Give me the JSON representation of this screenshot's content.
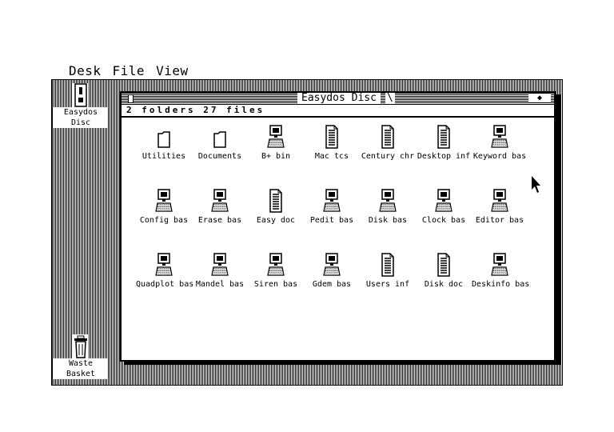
{
  "menubar": {
    "items": [
      "Desk",
      "File",
      "View"
    ]
  },
  "desktop": {
    "drive_icon_label": "Easydos Disc",
    "trash_icon_label": "Waste Basket"
  },
  "window": {
    "title": "Easydos Disc",
    "title_suffix": "\\",
    "fullbox": "◆",
    "info": "2 folders 27 files"
  },
  "files": [
    {
      "name": "Utilities",
      "icon": "folder-icon"
    },
    {
      "name": "Documents",
      "icon": "folder-icon"
    },
    {
      "name": "B+ bin",
      "icon": "program-icon"
    },
    {
      "name": "Mac tcs",
      "icon": "document-icon"
    },
    {
      "name": "Century chr",
      "icon": "document-icon"
    },
    {
      "name": "Desktop inf",
      "icon": "document-icon"
    },
    {
      "name": "Keyword bas",
      "icon": "program-icon"
    },
    {
      "name": "Config bas",
      "icon": "program-icon"
    },
    {
      "name": "Erase bas",
      "icon": "program-icon"
    },
    {
      "name": "Easy doc",
      "icon": "document-icon"
    },
    {
      "name": "Pedit bas",
      "icon": "program-icon"
    },
    {
      "name": "Disk bas",
      "icon": "program-icon"
    },
    {
      "name": "Clock bas",
      "icon": "program-icon"
    },
    {
      "name": "Editor bas",
      "icon": "program-icon"
    },
    {
      "name": "Quadplot bas",
      "icon": "program-icon"
    },
    {
      "name": "Mandel bas",
      "icon": "program-icon"
    },
    {
      "name": "Siren bas",
      "icon": "program-icon"
    },
    {
      "name": "Gdem bas",
      "icon": "program-icon"
    },
    {
      "name": "Users inf",
      "icon": "document-icon"
    },
    {
      "name": "Disk doc",
      "icon": "document-icon"
    },
    {
      "name": "Deskinfo bas",
      "icon": "program-icon"
    }
  ]
}
